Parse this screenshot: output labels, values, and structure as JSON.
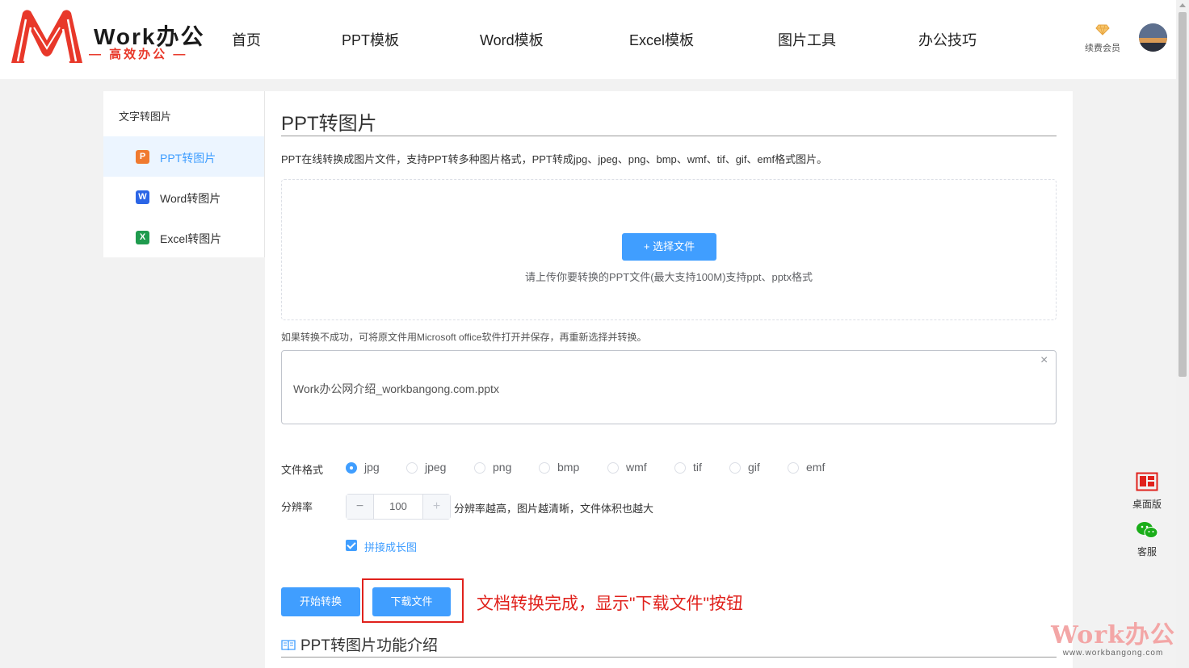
{
  "header": {
    "logo": {
      "name": "Work办公",
      "slogan": "— 高效办公 —"
    },
    "nav": [
      {
        "label": "首页"
      },
      {
        "label": "PPT模板"
      },
      {
        "label": "Word模板"
      },
      {
        "label": "Excel模板"
      },
      {
        "label": "图片工具"
      },
      {
        "label": "办公技巧"
      }
    ],
    "vip_label": "续费会员"
  },
  "sidebar": {
    "title": "文字转图片",
    "items": [
      {
        "label": "PPT转图片",
        "icon": "ppt-icon",
        "icon_letter": "P",
        "icon_color": "#f07a2f",
        "active": true
      },
      {
        "label": "Word转图片",
        "icon": "word-icon",
        "icon_letter": "W",
        "icon_color": "#2b65e6",
        "active": false
      },
      {
        "label": "Excel转图片",
        "icon": "excel-icon",
        "icon_letter": "X",
        "icon_color": "#1f9b4e",
        "active": false
      }
    ]
  },
  "main": {
    "title": "PPT转图片",
    "description": "PPT在线转换成图片文件，支持PPT转多种图片格式，PPT转成jpg、jpeg、png、bmp、wmf、tif、gif、emf格式图片。",
    "upload": {
      "button_label": "+ 选择文件",
      "tip": "请上传你要转换的PPT文件(最大支持100M)支持ppt、pptx格式"
    },
    "note": "如果转换不成功，可将原文件用Microsoft office软件打开并保存，再重新选择并转换。",
    "file": {
      "name": "Work办公网介绍_workbangong.com.pptx",
      "close": "×"
    },
    "format": {
      "label": "文件格式",
      "options": [
        "jpg",
        "jpeg",
        "png",
        "bmp",
        "wmf",
        "tif",
        "gif",
        "emf"
      ],
      "selected": "jpg"
    },
    "resolution": {
      "label": "分辨率",
      "minus": "−",
      "value": "100",
      "plus": "+",
      "tip": "分辨率越高，图片越清晰，文件体积也越大"
    },
    "merge": {
      "label": "拼接成长图",
      "checked": true
    },
    "buttons": {
      "start": "开始转换",
      "download": "下载文件"
    },
    "annotation": "文档转换完成，显示\"下载文件\"按钮",
    "section_title": "PPT转图片功能介绍"
  },
  "right_tools": [
    {
      "label": "桌面版",
      "icon": "desktop-icon"
    },
    {
      "label": "客服",
      "icon": "wechat-icon"
    }
  ],
  "watermark": {
    "name": "Work办公",
    "url": "www.workbangong.com"
  },
  "colors": {
    "primary": "#409eff",
    "brand_red": "#e8382a",
    "annotation_red": "#e0211c"
  }
}
